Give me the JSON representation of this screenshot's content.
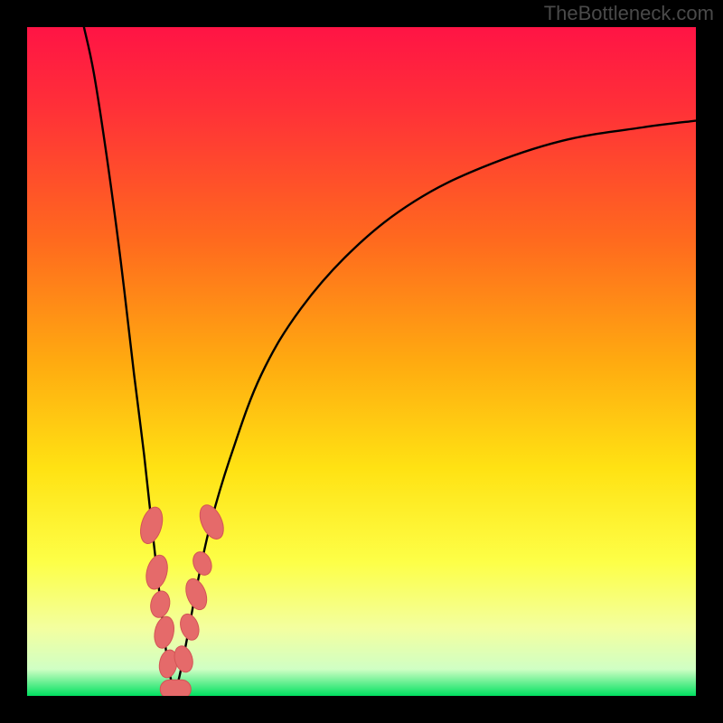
{
  "watermark": "TheBottleneck.com",
  "colors": {
    "frame_bg": "#000000",
    "gradient_top": "#ff1445",
    "gradient_1": "#ff3038",
    "gradient_2": "#ff6a1e",
    "gradient_3": "#ffaa10",
    "gradient_4": "#ffe213",
    "gradient_5": "#fdff47",
    "gradient_6": "#f3ffa0",
    "gradient_7": "#d0ffc4",
    "gradient_bottom": "#00e060",
    "curve": "#000000",
    "marker_fill": "#e56a6a",
    "marker_stroke": "#d35454"
  },
  "chart_data": {
    "type": "line",
    "title": "",
    "xlabel": "",
    "ylabel": "",
    "xlim": [
      0,
      100
    ],
    "ylim": [
      0,
      100
    ],
    "notch_x": 22,
    "curves": [
      {
        "name": "left",
        "points": [
          {
            "x": 8.5,
            "y": 100
          },
          {
            "x": 10,
            "y": 93
          },
          {
            "x": 12,
            "y": 80
          },
          {
            "x": 14,
            "y": 65
          },
          {
            "x": 16,
            "y": 48
          },
          {
            "x": 17.5,
            "y": 36
          },
          {
            "x": 18.7,
            "y": 25
          },
          {
            "x": 19.6,
            "y": 17
          },
          {
            "x": 20.4,
            "y": 10
          },
          {
            "x": 21.0,
            "y": 5
          },
          {
            "x": 21.6,
            "y": 2
          },
          {
            "x": 22.0,
            "y": 0
          }
        ]
      },
      {
        "name": "right",
        "points": [
          {
            "x": 22.0,
            "y": 0
          },
          {
            "x": 22.8,
            "y": 3
          },
          {
            "x": 24.0,
            "y": 9
          },
          {
            "x": 25.5,
            "y": 17
          },
          {
            "x": 27.5,
            "y": 26
          },
          {
            "x": 30.5,
            "y": 36
          },
          {
            "x": 35,
            "y": 48
          },
          {
            "x": 41,
            "y": 58
          },
          {
            "x": 49,
            "y": 67
          },
          {
            "x": 58,
            "y": 74
          },
          {
            "x": 68,
            "y": 79
          },
          {
            "x": 80,
            "y": 83
          },
          {
            "x": 92,
            "y": 85
          },
          {
            "x": 100,
            "y": 86
          }
        ]
      }
    ],
    "markers": [
      {
        "shape": "ellipse",
        "cx": 18.6,
        "cy": 25.5,
        "rx": 1.5,
        "ry": 2.8,
        "rot": 16
      },
      {
        "shape": "ellipse",
        "cx": 19.4,
        "cy": 18.5,
        "rx": 1.5,
        "ry": 2.6,
        "rot": 14
      },
      {
        "shape": "ellipse",
        "cx": 19.9,
        "cy": 13.7,
        "rx": 1.4,
        "ry": 2.0,
        "rot": 12
      },
      {
        "shape": "ellipse",
        "cx": 20.5,
        "cy": 9.5,
        "rx": 1.4,
        "ry": 2.4,
        "rot": 12
      },
      {
        "shape": "ellipse",
        "cx": 21.1,
        "cy": 4.8,
        "rx": 1.3,
        "ry": 2.1,
        "rot": 10
      },
      {
        "shape": "capsule",
        "cx": 22.2,
        "cy": 1.0,
        "rx": 2.3,
        "ry": 1.4,
        "rot": 0
      },
      {
        "shape": "ellipse",
        "cx": 23.4,
        "cy": 5.5,
        "rx": 1.3,
        "ry": 2.0,
        "rot": -16
      },
      {
        "shape": "ellipse",
        "cx": 24.3,
        "cy": 10.3,
        "rx": 1.3,
        "ry": 2.0,
        "rot": -18
      },
      {
        "shape": "ellipse",
        "cx": 25.3,
        "cy": 15.2,
        "rx": 1.4,
        "ry": 2.4,
        "rot": -20
      },
      {
        "shape": "ellipse",
        "cx": 26.2,
        "cy": 19.8,
        "rx": 1.3,
        "ry": 1.8,
        "rot": -22
      },
      {
        "shape": "ellipse",
        "cx": 27.6,
        "cy": 26.0,
        "rx": 1.5,
        "ry": 2.7,
        "rot": -24
      }
    ]
  }
}
